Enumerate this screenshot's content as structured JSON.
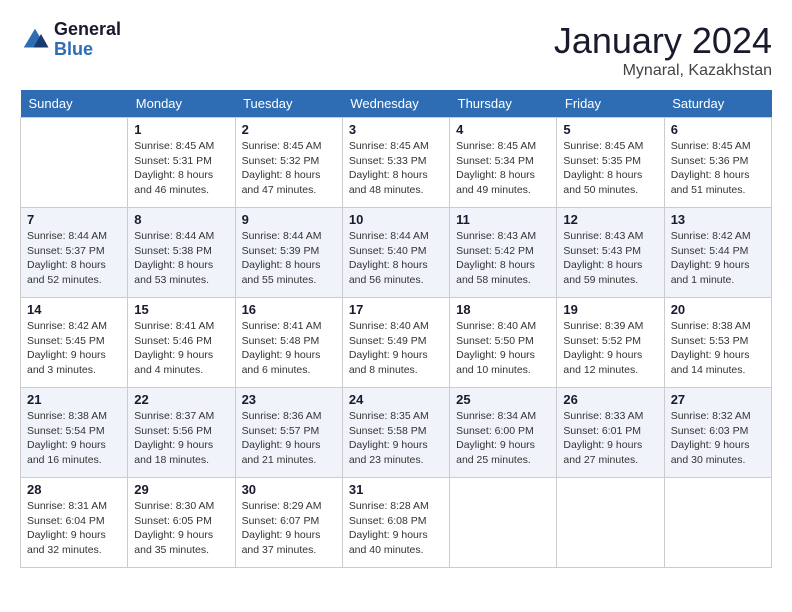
{
  "logo": {
    "general": "General",
    "blue": "Blue"
  },
  "title": "January 2024",
  "location": "Mynaral, Kazakhstan",
  "weekdays": [
    "Sunday",
    "Monday",
    "Tuesday",
    "Wednesday",
    "Thursday",
    "Friday",
    "Saturday"
  ],
  "weeks": [
    [
      {
        "day": "",
        "sunrise": "",
        "sunset": "",
        "daylight": ""
      },
      {
        "day": "1",
        "sunrise": "Sunrise: 8:45 AM",
        "sunset": "Sunset: 5:31 PM",
        "daylight": "Daylight: 8 hours and 46 minutes."
      },
      {
        "day": "2",
        "sunrise": "Sunrise: 8:45 AM",
        "sunset": "Sunset: 5:32 PM",
        "daylight": "Daylight: 8 hours and 47 minutes."
      },
      {
        "day": "3",
        "sunrise": "Sunrise: 8:45 AM",
        "sunset": "Sunset: 5:33 PM",
        "daylight": "Daylight: 8 hours and 48 minutes."
      },
      {
        "day": "4",
        "sunrise": "Sunrise: 8:45 AM",
        "sunset": "Sunset: 5:34 PM",
        "daylight": "Daylight: 8 hours and 49 minutes."
      },
      {
        "day": "5",
        "sunrise": "Sunrise: 8:45 AM",
        "sunset": "Sunset: 5:35 PM",
        "daylight": "Daylight: 8 hours and 50 minutes."
      },
      {
        "day": "6",
        "sunrise": "Sunrise: 8:45 AM",
        "sunset": "Sunset: 5:36 PM",
        "daylight": "Daylight: 8 hours and 51 minutes."
      }
    ],
    [
      {
        "day": "7",
        "sunrise": "Sunrise: 8:44 AM",
        "sunset": "Sunset: 5:37 PM",
        "daylight": "Daylight: 8 hours and 52 minutes."
      },
      {
        "day": "8",
        "sunrise": "Sunrise: 8:44 AM",
        "sunset": "Sunset: 5:38 PM",
        "daylight": "Daylight: 8 hours and 53 minutes."
      },
      {
        "day": "9",
        "sunrise": "Sunrise: 8:44 AM",
        "sunset": "Sunset: 5:39 PM",
        "daylight": "Daylight: 8 hours and 55 minutes."
      },
      {
        "day": "10",
        "sunrise": "Sunrise: 8:44 AM",
        "sunset": "Sunset: 5:40 PM",
        "daylight": "Daylight: 8 hours and 56 minutes."
      },
      {
        "day": "11",
        "sunrise": "Sunrise: 8:43 AM",
        "sunset": "Sunset: 5:42 PM",
        "daylight": "Daylight: 8 hours and 58 minutes."
      },
      {
        "day": "12",
        "sunrise": "Sunrise: 8:43 AM",
        "sunset": "Sunset: 5:43 PM",
        "daylight": "Daylight: 8 hours and 59 minutes."
      },
      {
        "day": "13",
        "sunrise": "Sunrise: 8:42 AM",
        "sunset": "Sunset: 5:44 PM",
        "daylight": "Daylight: 9 hours and 1 minute."
      }
    ],
    [
      {
        "day": "14",
        "sunrise": "Sunrise: 8:42 AM",
        "sunset": "Sunset: 5:45 PM",
        "daylight": "Daylight: 9 hours and 3 minutes."
      },
      {
        "day": "15",
        "sunrise": "Sunrise: 8:41 AM",
        "sunset": "Sunset: 5:46 PM",
        "daylight": "Daylight: 9 hours and 4 minutes."
      },
      {
        "day": "16",
        "sunrise": "Sunrise: 8:41 AM",
        "sunset": "Sunset: 5:48 PM",
        "daylight": "Daylight: 9 hours and 6 minutes."
      },
      {
        "day": "17",
        "sunrise": "Sunrise: 8:40 AM",
        "sunset": "Sunset: 5:49 PM",
        "daylight": "Daylight: 9 hours and 8 minutes."
      },
      {
        "day": "18",
        "sunrise": "Sunrise: 8:40 AM",
        "sunset": "Sunset: 5:50 PM",
        "daylight": "Daylight: 9 hours and 10 minutes."
      },
      {
        "day": "19",
        "sunrise": "Sunrise: 8:39 AM",
        "sunset": "Sunset: 5:52 PM",
        "daylight": "Daylight: 9 hours and 12 minutes."
      },
      {
        "day": "20",
        "sunrise": "Sunrise: 8:38 AM",
        "sunset": "Sunset: 5:53 PM",
        "daylight": "Daylight: 9 hours and 14 minutes."
      }
    ],
    [
      {
        "day": "21",
        "sunrise": "Sunrise: 8:38 AM",
        "sunset": "Sunset: 5:54 PM",
        "daylight": "Daylight: 9 hours and 16 minutes."
      },
      {
        "day": "22",
        "sunrise": "Sunrise: 8:37 AM",
        "sunset": "Sunset: 5:56 PM",
        "daylight": "Daylight: 9 hours and 18 minutes."
      },
      {
        "day": "23",
        "sunrise": "Sunrise: 8:36 AM",
        "sunset": "Sunset: 5:57 PM",
        "daylight": "Daylight: 9 hours and 21 minutes."
      },
      {
        "day": "24",
        "sunrise": "Sunrise: 8:35 AM",
        "sunset": "Sunset: 5:58 PM",
        "daylight": "Daylight: 9 hours and 23 minutes."
      },
      {
        "day": "25",
        "sunrise": "Sunrise: 8:34 AM",
        "sunset": "Sunset: 6:00 PM",
        "daylight": "Daylight: 9 hours and 25 minutes."
      },
      {
        "day": "26",
        "sunrise": "Sunrise: 8:33 AM",
        "sunset": "Sunset: 6:01 PM",
        "daylight": "Daylight: 9 hours and 27 minutes."
      },
      {
        "day": "27",
        "sunrise": "Sunrise: 8:32 AM",
        "sunset": "Sunset: 6:03 PM",
        "daylight": "Daylight: 9 hours and 30 minutes."
      }
    ],
    [
      {
        "day": "28",
        "sunrise": "Sunrise: 8:31 AM",
        "sunset": "Sunset: 6:04 PM",
        "daylight": "Daylight: 9 hours and 32 minutes."
      },
      {
        "day": "29",
        "sunrise": "Sunrise: 8:30 AM",
        "sunset": "Sunset: 6:05 PM",
        "daylight": "Daylight: 9 hours and 35 minutes."
      },
      {
        "day": "30",
        "sunrise": "Sunrise: 8:29 AM",
        "sunset": "Sunset: 6:07 PM",
        "daylight": "Daylight: 9 hours and 37 minutes."
      },
      {
        "day": "31",
        "sunrise": "Sunrise: 8:28 AM",
        "sunset": "Sunset: 6:08 PM",
        "daylight": "Daylight: 9 hours and 40 minutes."
      },
      {
        "day": "",
        "sunrise": "",
        "sunset": "",
        "daylight": ""
      },
      {
        "day": "",
        "sunrise": "",
        "sunset": "",
        "daylight": ""
      },
      {
        "day": "",
        "sunrise": "",
        "sunset": "",
        "daylight": ""
      }
    ]
  ]
}
